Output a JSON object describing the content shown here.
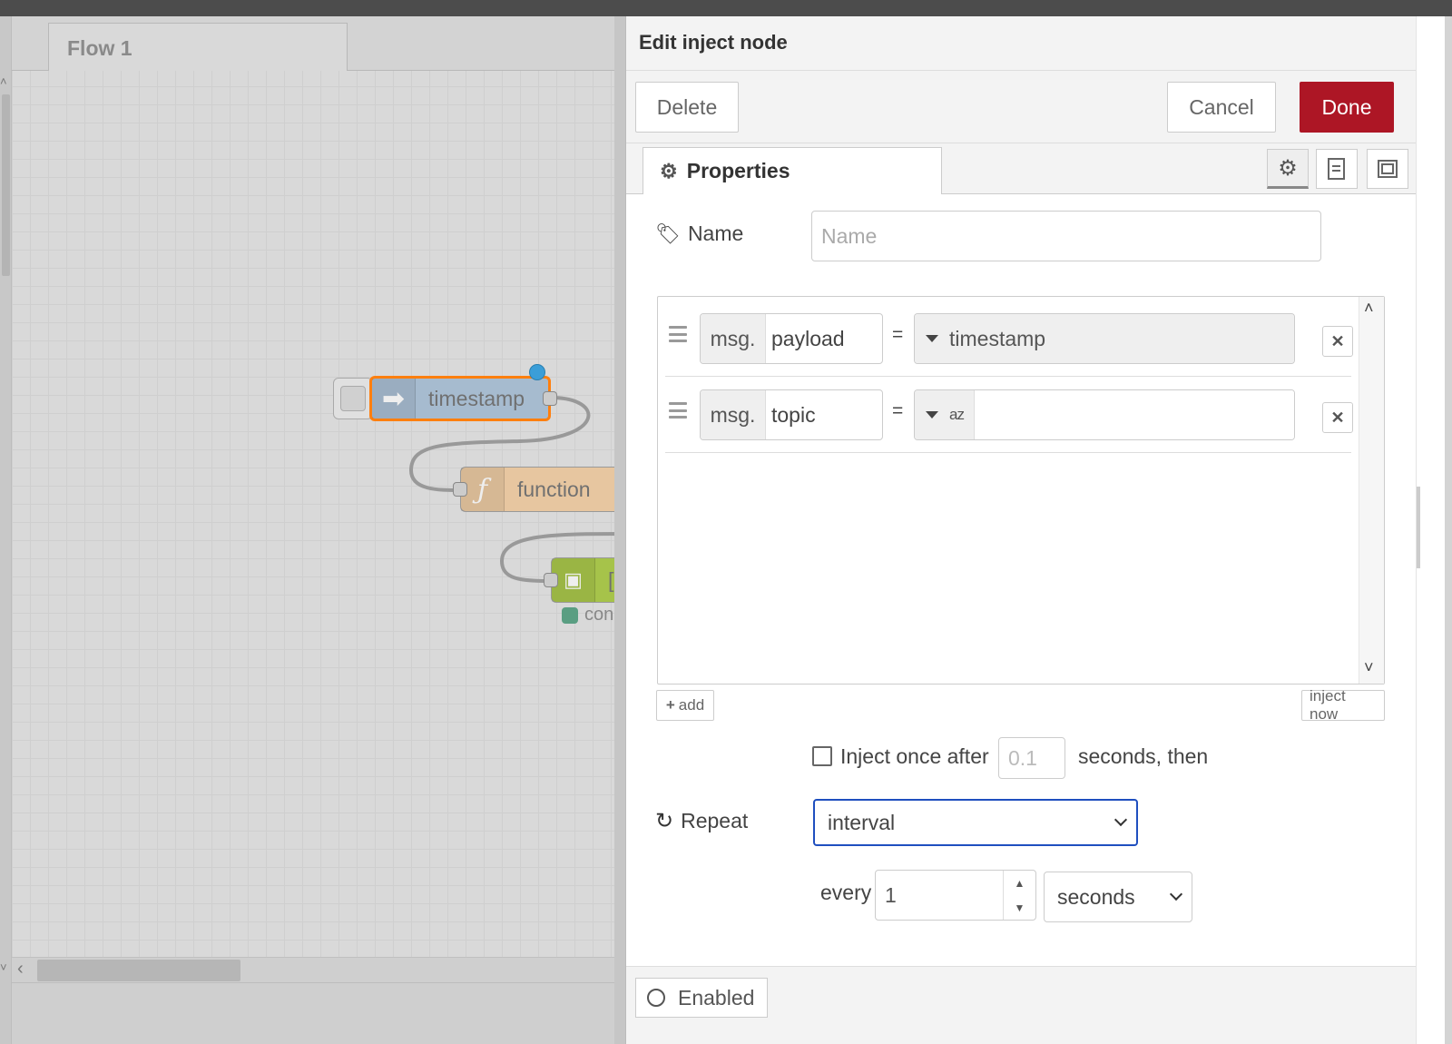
{
  "workspace": {
    "flow_tab_label": "Flow 1",
    "nodes": {
      "inject_label": "timestamp",
      "function_label": "function",
      "output_label": "[",
      "output_status": "con"
    }
  },
  "editor": {
    "title": "Edit inject node",
    "buttons": {
      "delete": "Delete",
      "cancel": "Cancel",
      "done": "Done"
    },
    "tab_properties": "Properties",
    "name_label": "Name",
    "name_placeholder": "Name",
    "props": [
      {
        "prefix": "msg.",
        "key": "payload",
        "eq": "=",
        "type_label": "timestamp"
      },
      {
        "prefix": "msg.",
        "key": "topic",
        "eq": "=",
        "type_label": "az"
      }
    ],
    "add_label": "add",
    "inject_now_label": "inject now",
    "inject_once_label": "Inject once after",
    "inject_once_value": "0.1",
    "seconds_then_label": "seconds, then",
    "repeat_label": "Repeat",
    "repeat_value": "interval",
    "every_label": "every",
    "every_value": "1",
    "unit_value": "seconds",
    "enabled_label": "Enabled"
  },
  "colors": {
    "done_button": "#ad1625",
    "inject_node": "#a6bbcf",
    "function_node": "#e7c6a0",
    "output_node": "#a6c34a",
    "selected_outline": "#ff7f0e",
    "focus_border": "#1f4fbf"
  }
}
